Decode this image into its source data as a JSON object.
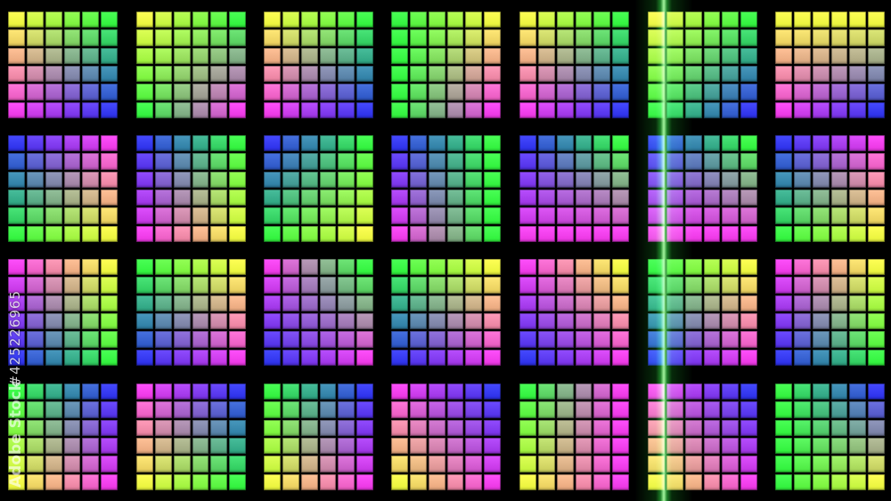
{
  "scene": {
    "description_colors": {
      "yellow": "#e6f23a",
      "green": "#2ef03a",
      "blue": "#2a2ee6",
      "magenta": "#e834e0",
      "background": "#000000",
      "beam": "#3cff50"
    },
    "panel_gradients": [
      [
        "yellow-green-top",
        "magenta-blue-bottom"
      ]
    ]
  },
  "watermark": {
    "asset_id": "#425226965",
    "brand": "Adobe Stock"
  }
}
